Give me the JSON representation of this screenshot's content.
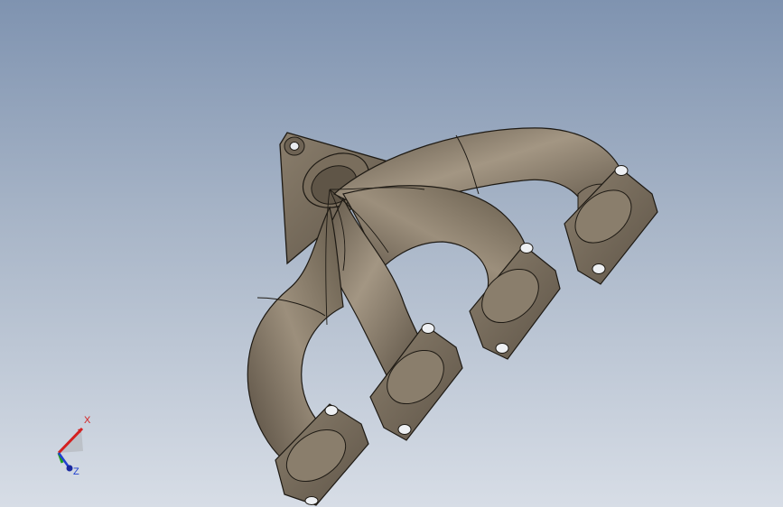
{
  "viewport": {
    "background_top": "#7f93b0",
    "background_bottom": "#d7dde6"
  },
  "model": {
    "part_color": "#7d7060",
    "edge_color": "#1e1a14"
  },
  "triad": {
    "x_label": "X",
    "z_label": "Z",
    "x_color": "#d42020",
    "y_color": "#20a020",
    "z_color": "#2040d0"
  }
}
